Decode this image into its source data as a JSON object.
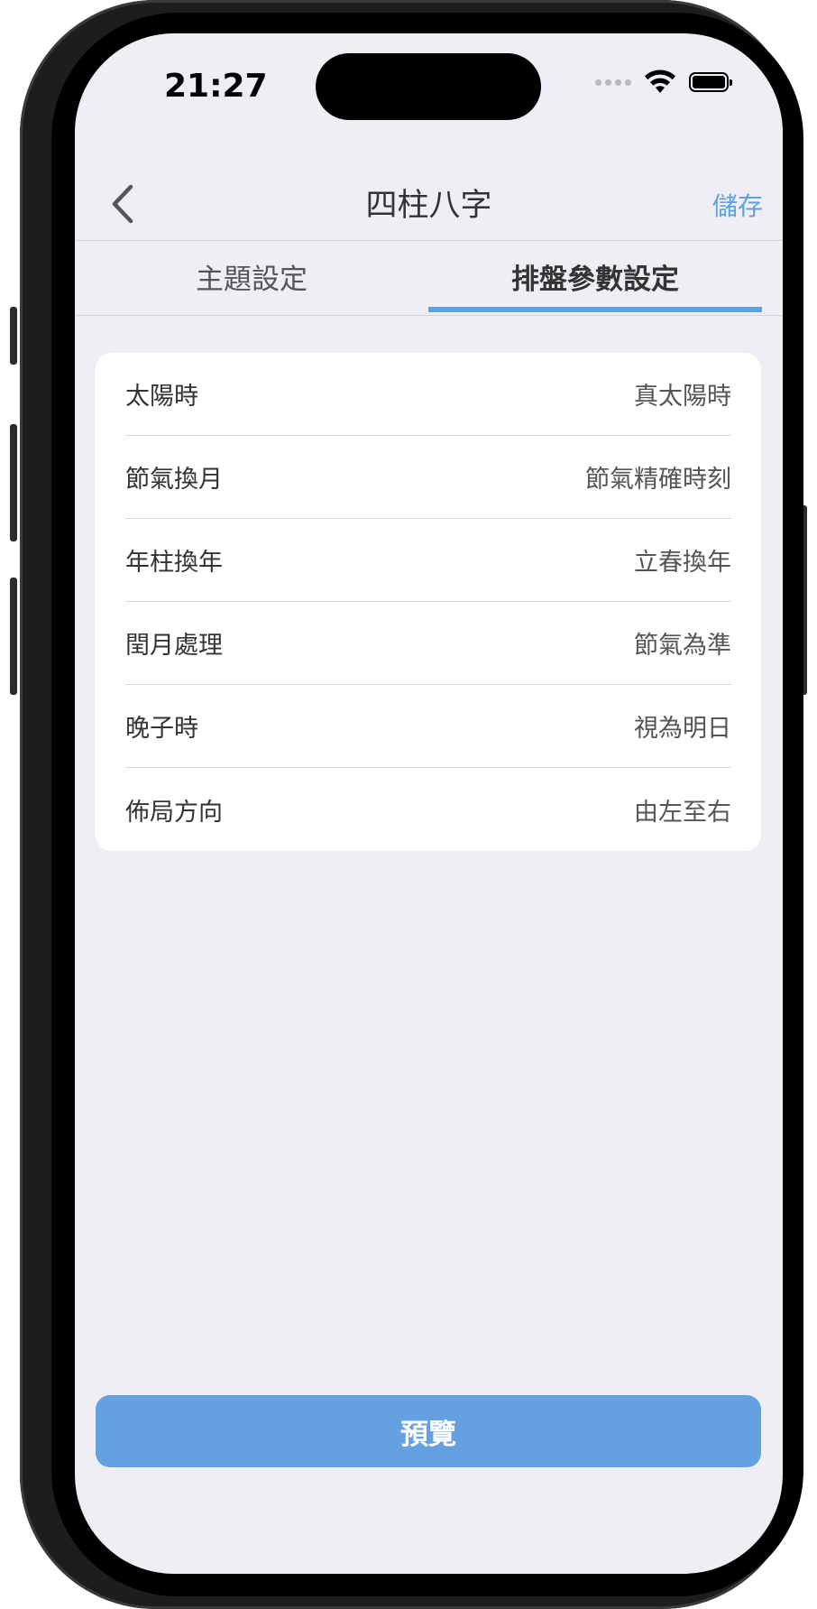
{
  "status_bar": {
    "time": "21:27"
  },
  "nav": {
    "title": "四柱八字",
    "save_label": "儲存"
  },
  "tabs": [
    {
      "label": "主題設定",
      "active": false
    },
    {
      "label": "排盤參數設定",
      "active": true
    }
  ],
  "settings": [
    {
      "label": "太陽時",
      "value": "真太陽時"
    },
    {
      "label": "節氣換月",
      "value": "節氣精確時刻"
    },
    {
      "label": "年柱換年",
      "value": "立春換年"
    },
    {
      "label": "閏月處理",
      "value": "節氣為準"
    },
    {
      "label": "晚子時",
      "value": "視為明日"
    },
    {
      "label": "佈局方向",
      "value": "由左至右"
    }
  ],
  "preview_button": {
    "label": "預覽"
  },
  "colors": {
    "accent": "#5fa0de",
    "button": "#63a1e0",
    "background": "#efeef4"
  }
}
